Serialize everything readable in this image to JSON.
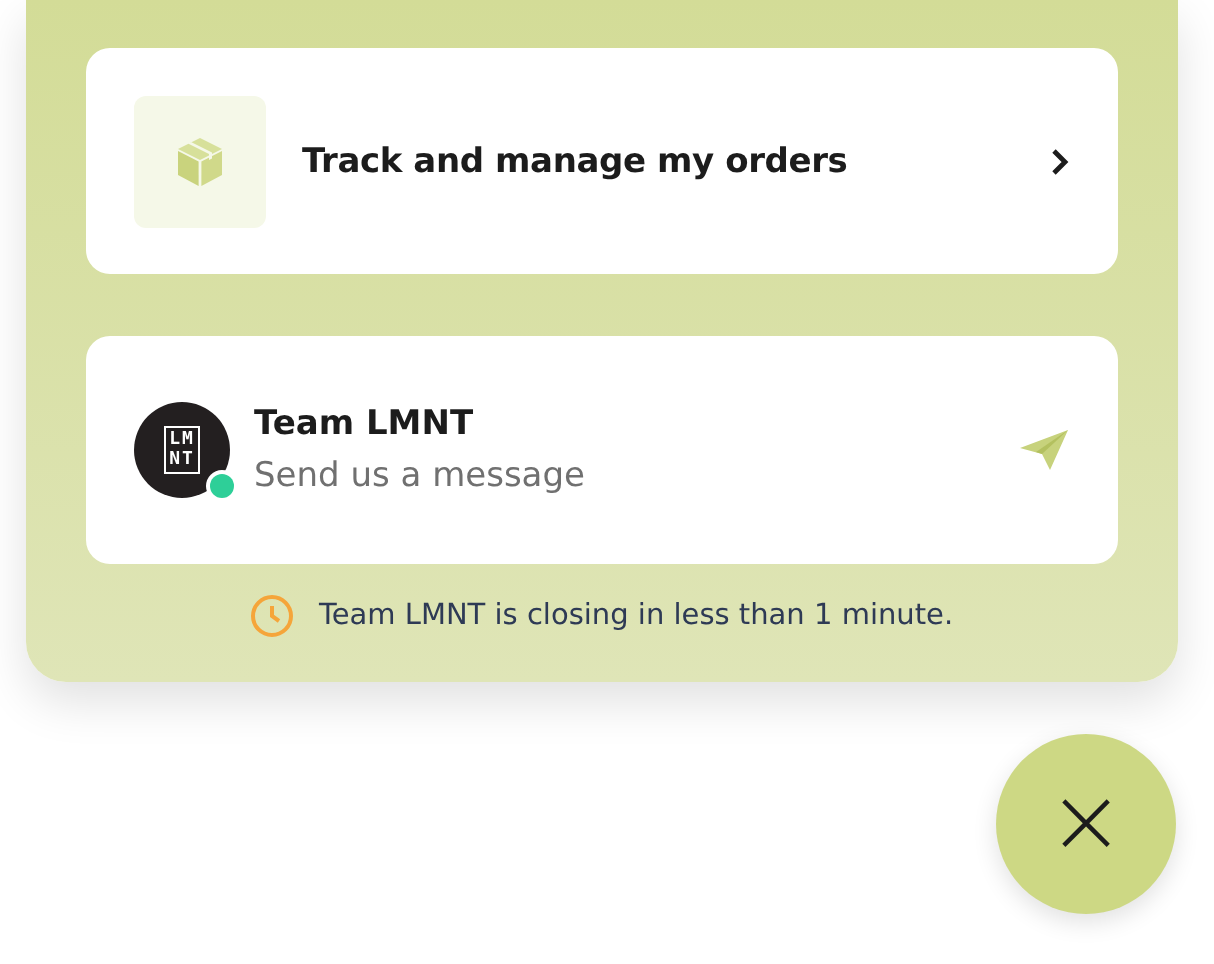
{
  "orders_card": {
    "label": "Track and manage my orders"
  },
  "message_card": {
    "team_name": "Team LMNT",
    "prompt": "Send us a message",
    "avatar_text": [
      "LM",
      "NT"
    ],
    "online": true
  },
  "notice": {
    "text": "Team LMNT is closing in less than 1 minute."
  },
  "close_button": {
    "label": "×"
  }
}
